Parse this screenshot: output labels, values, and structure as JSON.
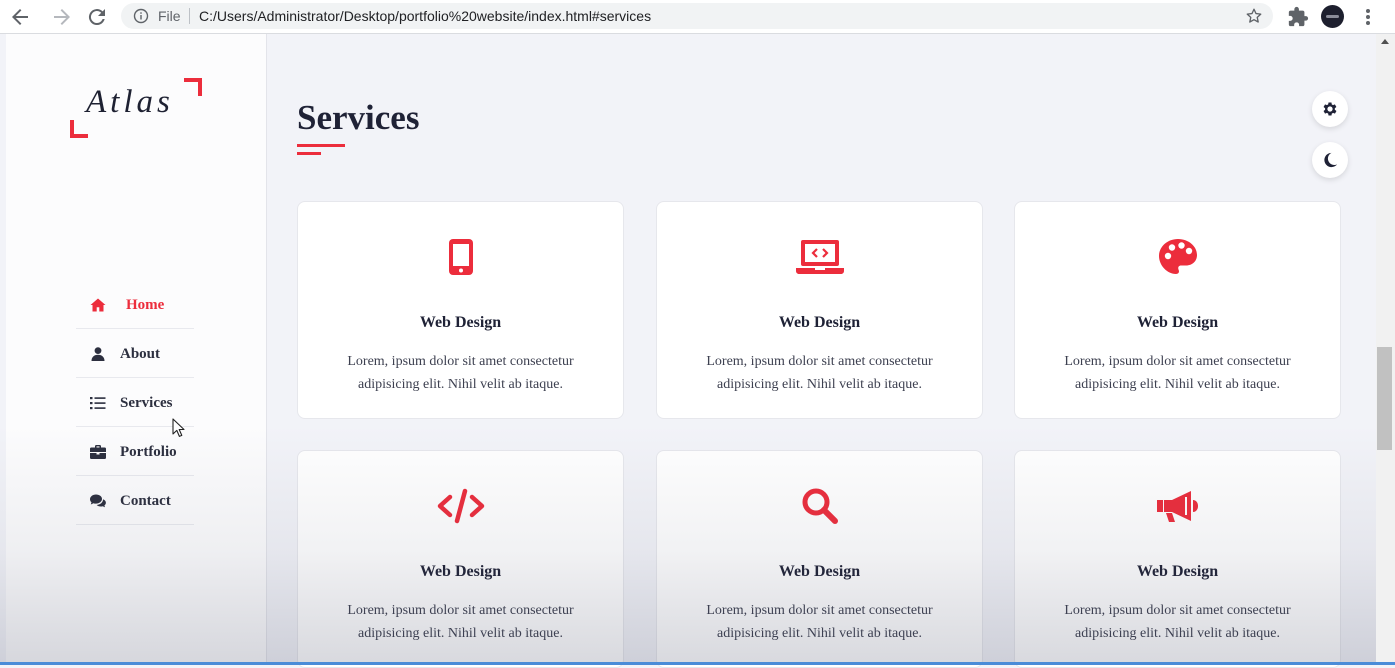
{
  "browser": {
    "file_label": "File",
    "url": "C:/Users/Administrator/Desktop/portfolio%20website/index.html#services"
  },
  "sidebar": {
    "logo_text": "Atlas",
    "menu": [
      {
        "label": "Home",
        "icon": "home-icon",
        "active": true
      },
      {
        "label": "About",
        "icon": "user-icon",
        "active": false
      },
      {
        "label": "Services",
        "icon": "list-icon",
        "active": false
      },
      {
        "label": "Portfolio",
        "icon": "briefcase-icon",
        "active": false
      },
      {
        "label": "Contact",
        "icon": "comments-icon",
        "active": false
      }
    ]
  },
  "main": {
    "title": "Services",
    "cards": [
      {
        "icon": "mobile-icon",
        "title": "Web Design",
        "text": "Lorem, ipsum dolor sit amet consectetur adipisicing elit. Nihil velit ab itaque."
      },
      {
        "icon": "laptop-code-icon",
        "title": "Web Design",
        "text": "Lorem, ipsum dolor sit amet consectetur adipisicing elit. Nihil velit ab itaque."
      },
      {
        "icon": "palette-icon",
        "title": "Web Design",
        "text": "Lorem, ipsum dolor sit amet consectetur adipisicing elit. Nihil velit ab itaque."
      },
      {
        "icon": "code-icon",
        "title": "Web Design",
        "text": "Lorem, ipsum dolor sit amet consectetur adipisicing elit. Nihil velit ab itaque."
      },
      {
        "icon": "search-icon",
        "title": "Web Design",
        "text": "Lorem, ipsum dolor sit amet consectetur adipisicing elit. Nihil velit ab itaque."
      },
      {
        "icon": "bullhorn-icon",
        "title": "Web Design",
        "text": "Lorem, ipsum dolor sit amet consectetur adipisicing elit. Nihil velit ab itaque."
      }
    ]
  },
  "colors": {
    "accent": "#ec2d3c",
    "dark_text": "#1f2236",
    "background": "#f2f3f8"
  }
}
